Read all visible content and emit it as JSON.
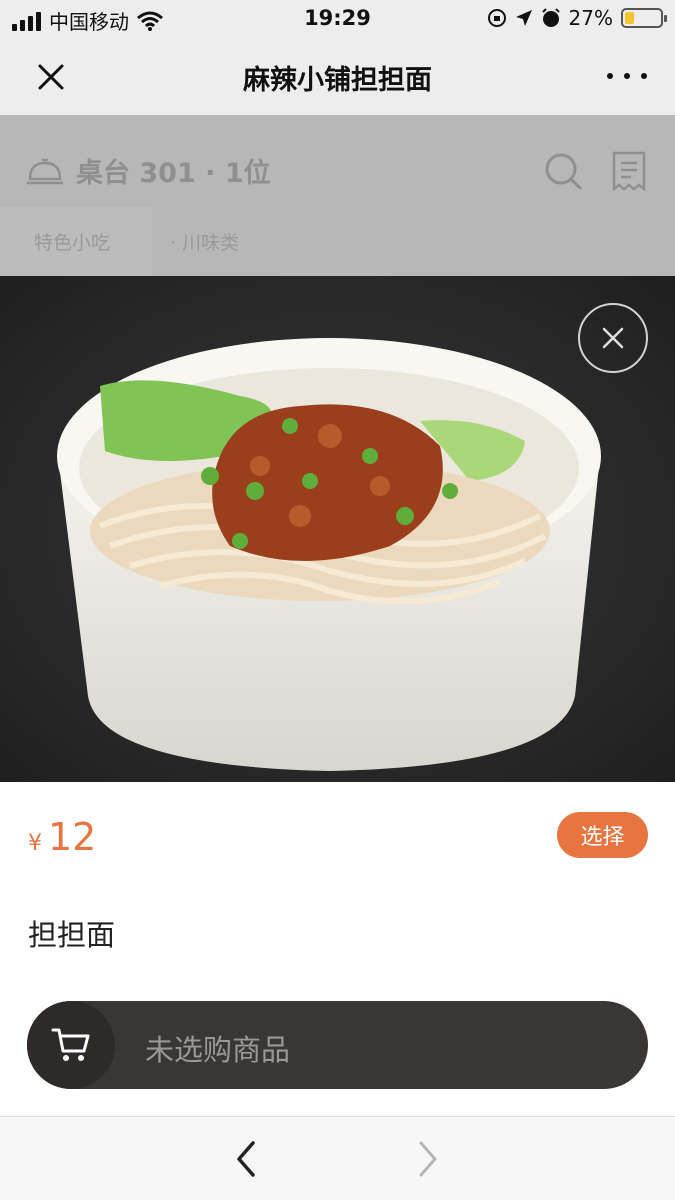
{
  "status_bar": {
    "carrier": "中国移动",
    "time": "19:29",
    "battery": "27%",
    "battery_level": 0.27
  },
  "title_bar": {
    "title": "麻辣小铺担担面",
    "close_icon": "close-icon",
    "more_icon": "more-icon"
  },
  "header": {
    "table_info": "桌台 301 · 1位",
    "bell_icon": "service-bell-icon",
    "search_icon": "search-icon",
    "order_icon": "receipt-icon",
    "categories": [
      {
        "label": "特色小吃"
      },
      {
        "label": "· 川味类"
      }
    ]
  },
  "dish": {
    "currency": "¥",
    "price": "12",
    "choose_label": "选择",
    "name": "担担面"
  },
  "cart": {
    "empty_label": "未选购商品",
    "icon": "cart-icon"
  },
  "colors": {
    "accent": "#e8743f",
    "cart_bar": "#3a3636",
    "overlay": "#b7b7b7"
  },
  "bottom_nav": {
    "back_icon": "chevron-left-icon",
    "forward_icon": "chevron-right-icon"
  }
}
